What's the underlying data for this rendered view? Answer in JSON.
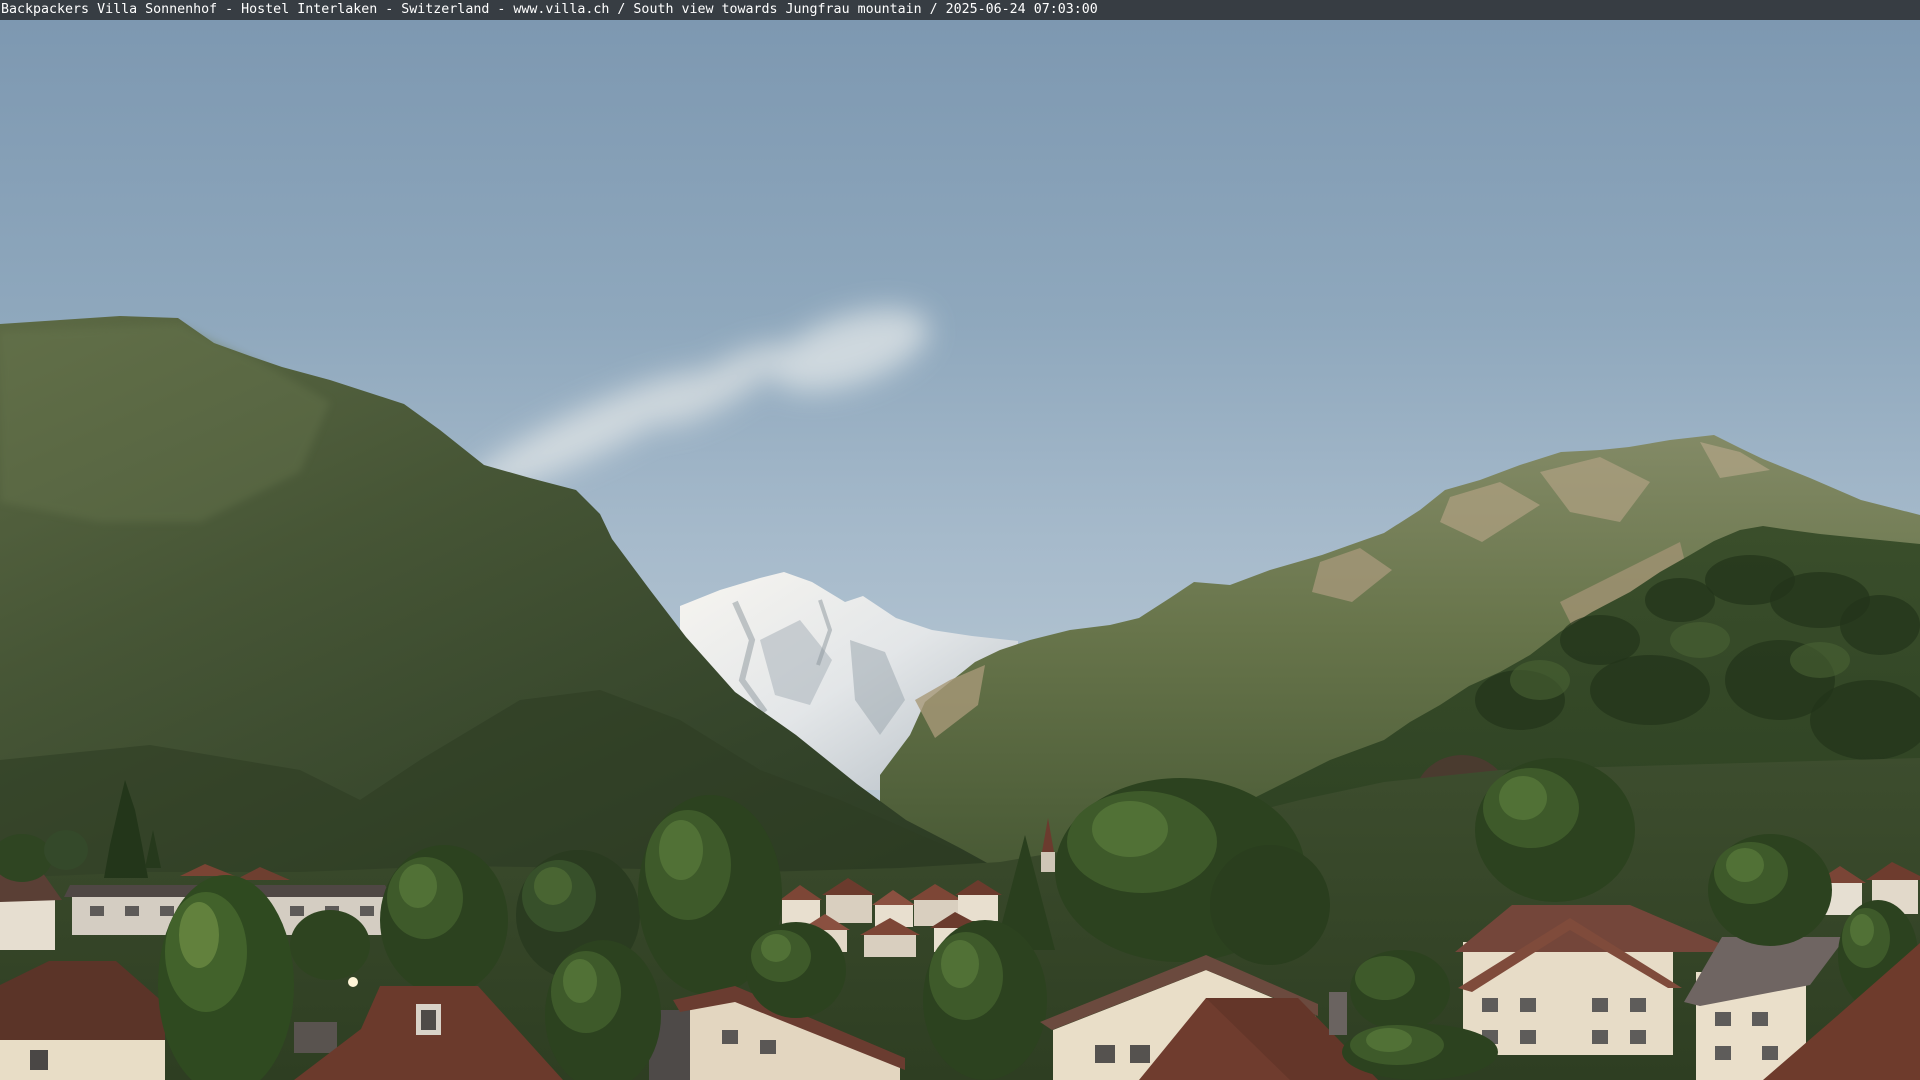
{
  "caption": {
    "text": "Backpackers Villa Sonnenhof - Hostel Interlaken - Switzerland - www.villa.ch / South view towards Jungfrau mountain / 2025-06-24 07:03:00"
  },
  "colors": {
    "caption_bar_background": "#373d43",
    "caption_text": "#ffffff"
  }
}
